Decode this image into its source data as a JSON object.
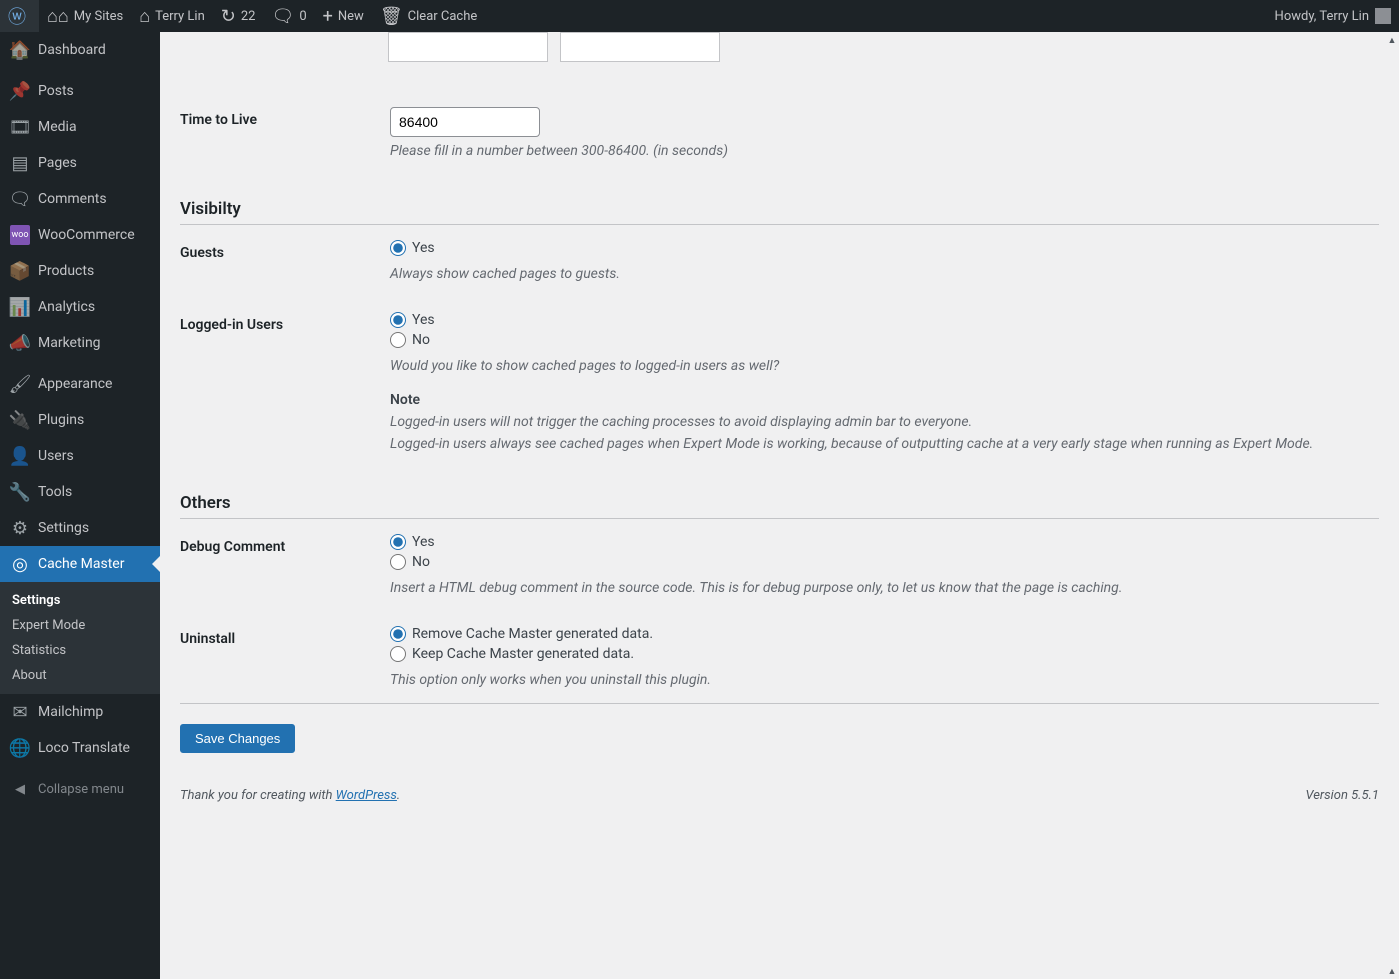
{
  "adminbar": {
    "my_sites": "My Sites",
    "site_name": "Terry Lin",
    "updates_count": "22",
    "comments_count": "0",
    "new": "New",
    "clear_cache": "Clear Cache",
    "howdy": "Howdy, Terry Lin"
  },
  "sidebar": {
    "items": [
      {
        "label": "Dashboard",
        "icon": "⌂"
      },
      {
        "label": "Posts",
        "icon": "📌"
      },
      {
        "label": "Media",
        "icon": "🎞"
      },
      {
        "label": "Pages",
        "icon": "▤"
      },
      {
        "label": "Comments",
        "icon": "💬"
      },
      {
        "label": "WooCommerce",
        "icon": "woo"
      },
      {
        "label": "Products",
        "icon": "📦"
      },
      {
        "label": "Analytics",
        "icon": "📊"
      },
      {
        "label": "Marketing",
        "icon": "📣"
      },
      {
        "label": "Appearance",
        "icon": "🖌"
      },
      {
        "label": "Plugins",
        "icon": "🔌"
      },
      {
        "label": "Users",
        "icon": "👤"
      },
      {
        "label": "Tools",
        "icon": "🔧"
      },
      {
        "label": "Settings",
        "icon": "⚙"
      },
      {
        "label": "Cache Master",
        "icon": "◎"
      },
      {
        "label": "Mailchimp",
        "icon": "✉"
      },
      {
        "label": "Loco Translate",
        "icon": "🌐"
      }
    ],
    "submenu": [
      {
        "label": "Settings",
        "active": true
      },
      {
        "label": "Expert Mode"
      },
      {
        "label": "Statistics"
      },
      {
        "label": "About"
      }
    ],
    "collapse": "Collapse menu"
  },
  "settings": {
    "ttl": {
      "label": "Time to Live",
      "value": "86400",
      "desc": "Please fill in a number between 300-86400. (in seconds)"
    },
    "visibility_heading": "Visibilty",
    "guests": {
      "label": "Guests",
      "yes": "Yes",
      "desc": "Always show cached pages to guests."
    },
    "logged_in": {
      "label": "Logged-in Users",
      "yes": "Yes",
      "no": "No",
      "desc": "Would you like to show cached pages to logged-in users as well?"
    },
    "note_heading": "Note",
    "note1": "Logged-in users will not trigger the caching processes to avoid displaying admin bar to everyone.",
    "note2": "Logged-in users always see cached pages when Expert Mode is working, because of outputting cache at a very early stage when running as Expert Mode.",
    "others_heading": "Others",
    "debug": {
      "label": "Debug Comment",
      "yes": "Yes",
      "no": "No",
      "desc": "Insert a HTML debug comment in the source code. This is for debug purpose only, to let us know that the page is caching."
    },
    "uninstall": {
      "label": "Uninstall",
      "remove": "Remove Cache Master generated data.",
      "keep": "Keep Cache Master generated data.",
      "desc": "This option only works when you uninstall this plugin."
    },
    "save": "Save Changes"
  },
  "footer": {
    "thank_you_pre": "Thank you for creating with ",
    "wp": "WordPress",
    "version": "Version 5.5.1"
  }
}
